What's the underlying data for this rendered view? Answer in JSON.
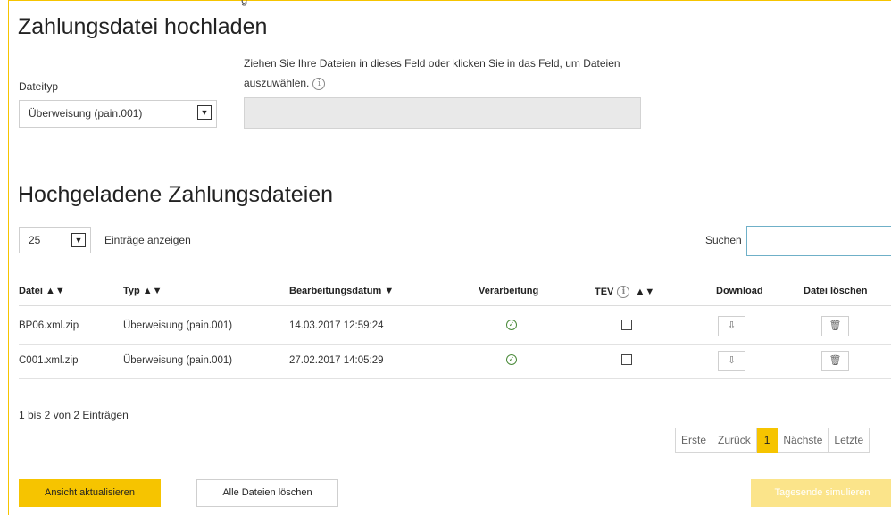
{
  "upload_section": {
    "title": "Zahlungsdatei hochladen",
    "top_cut_text": "g",
    "file_type_label": "Dateityp",
    "file_type_selected": "Überweisung (pain.001)",
    "drop_hint": "Ziehen Sie Ihre Dateien in dieses Feld oder klicken Sie in das Feld, um Dateien auszuwählen.",
    "info_glyph": "i"
  },
  "uploaded_section": {
    "title": "Hochgeladene Zahlungsdateien",
    "page_size": "25",
    "entries_label": "Einträge anzeigen",
    "search_label": "Suchen",
    "search_value": ""
  },
  "table": {
    "headers": {
      "file": "Datei ▲▼",
      "type": "Typ ▲▼",
      "date": "Bearbeitungsdatum ▼",
      "processing": "Verarbeitung",
      "tev": "TEV",
      "tev_sort": "▲▼",
      "download": "Download",
      "delete": "Datei löschen"
    },
    "rows": [
      {
        "file": "BP06.xml.zip",
        "type": "Überweisung (pain.001)",
        "date": "14.03.2017 12:59:24",
        "processed": true,
        "tev": false
      },
      {
        "file": "C001.xml.zip",
        "type": "Überweisung (pain.001)",
        "date": "27.02.2017 14:05:29",
        "processed": true,
        "tev": false
      }
    ]
  },
  "summary": "1 bis 2 von 2 Einträgen",
  "pagination": {
    "first": "Erste",
    "prev": "Zurück",
    "current": "1",
    "next": "Nächste",
    "last": "Letzte"
  },
  "buttons": {
    "refresh": "Ansicht aktualisieren",
    "delete_all": "Alle Dateien löschen",
    "simulate": "Tagesende simulieren"
  },
  "icons": {
    "check": "check-circle-icon",
    "download": "download-icon",
    "trash": "trash-icon",
    "info": "info-icon",
    "dropdown": "chevron-down-icon"
  },
  "colors": {
    "accent": "#f6c400",
    "accent_disabled": "#fbe48a",
    "success": "#4a8a3a",
    "search_border": "#6fb0c8"
  }
}
